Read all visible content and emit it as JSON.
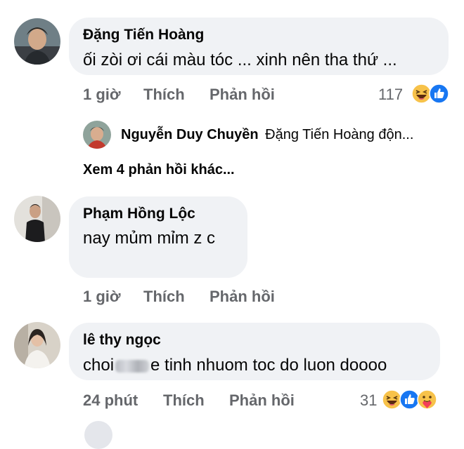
{
  "comments": [
    {
      "author": "Đặng Tiến Hoàng",
      "text": "ối zòi ơi cái màu tóc ... xinh nên tha thứ ...",
      "time": "1 giờ",
      "like_label": "Thích",
      "reply_label": "Phản hồi",
      "reaction_count": "117",
      "reactions": [
        "haha-emoji-icon",
        "like-emoji-icon"
      ],
      "reply_preview": {
        "author": "Nguyễn Duy Chuyền",
        "text": "Đặng Tiến Hoàng  độn..."
      },
      "more_replies": "Xem 4 phản hồi khác..."
    },
    {
      "author": "Phạm Hồng Lộc",
      "text": "nay mủm mỉm z c",
      "time": "1 giờ",
      "like_label": "Thích",
      "reply_label": "Phản hồi"
    },
    {
      "author": "lê thy ngọc",
      "text_before": "choi",
      "text_after": "e tinh nhuom toc do luon doooo",
      "time": "24 phút",
      "like_label": "Thích",
      "reply_label": "Phản hồi",
      "reaction_count": "31",
      "reactions": [
        "haha-emoji-icon",
        "like-emoji-icon",
        "care-emoji-icon"
      ]
    }
  ],
  "colors": {
    "bubble": "#f0f2f5",
    "secondary_text": "#65676b",
    "like_blue": "#1877f2",
    "haha_yellow": "#f7c24a"
  }
}
